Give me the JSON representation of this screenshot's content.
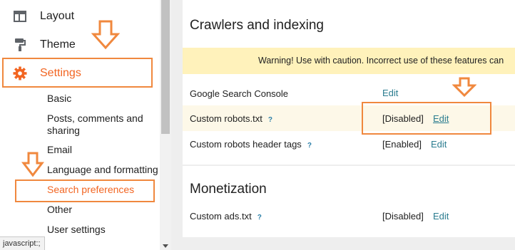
{
  "sidebar": {
    "layout_label": "Layout",
    "theme_label": "Theme",
    "settings_label": "Settings",
    "sub_items": [
      "Basic",
      "Posts, comments and",
      "sharing",
      "Email",
      "Language and formatting",
      "Search preferences",
      "Other",
      "User settings"
    ]
  },
  "status_bar": {
    "text": "javascript:;"
  },
  "crawlers": {
    "title": "Crawlers and indexing",
    "warning": "Warning! Use with caution. Incorrect use of these features can",
    "rows": [
      {
        "label": "Google Search Console",
        "status": "",
        "edit": "Edit"
      },
      {
        "label": "Custom robots.txt",
        "help": "?",
        "status": "[Disabled]",
        "edit": "Edit"
      },
      {
        "label": "Custom robots header tags",
        "help": "?",
        "status": "[Enabled]",
        "edit": "Edit"
      }
    ]
  },
  "monetization": {
    "title": "Monetization",
    "rows": [
      {
        "label": "Custom ads.txt",
        "help": "?",
        "status": "[Disabled]",
        "edit": "Edit"
      }
    ]
  },
  "colors": {
    "accent": "#f26522",
    "annotation": "#f0883e",
    "link": "#2a7c8f",
    "warning_bg": "#fff2bb"
  }
}
